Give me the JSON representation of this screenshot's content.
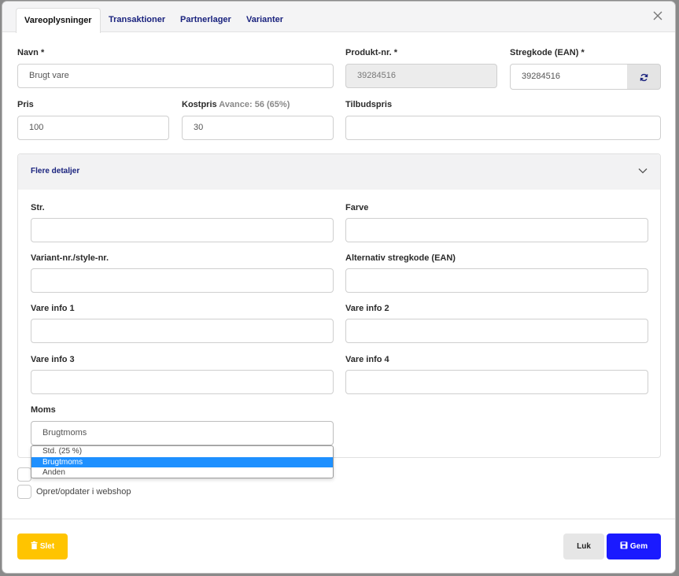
{
  "tabs": [
    {
      "label": "Vareoplysninger"
    },
    {
      "label": "Transaktioner"
    },
    {
      "label": "Partnerlager"
    },
    {
      "label": "Varianter"
    }
  ],
  "fields": {
    "navn": {
      "label": "Navn *",
      "value": "Brugt vare"
    },
    "produktnr": {
      "label": "Produkt-nr. *",
      "value": "39284516"
    },
    "stregkode": {
      "label": "Stregkode (EAN) *",
      "value": "39284516"
    },
    "pris": {
      "label": "Pris",
      "value": "100"
    },
    "kostpris": {
      "label": "Kostpris",
      "avance": "Avance: 56 (65%)",
      "value": "30"
    },
    "tilbudspris": {
      "label": "Tilbudspris",
      "value": ""
    }
  },
  "details": {
    "title": "Flere detaljer",
    "str": {
      "label": "Str.",
      "value": ""
    },
    "farve": {
      "label": "Farve",
      "value": ""
    },
    "variant": {
      "label": "Variant-nr./style-nr.",
      "value": ""
    },
    "alt_ean": {
      "label": "Alternativ stregkode (EAN)",
      "value": ""
    },
    "info1": {
      "label": "Vare info 1",
      "value": ""
    },
    "info2": {
      "label": "Vare info 2",
      "value": ""
    },
    "info3": {
      "label": "Vare info 3",
      "value": ""
    },
    "info4": {
      "label": "Vare info 4",
      "value": ""
    },
    "moms": {
      "label": "Moms",
      "value": "Brugtmoms",
      "options": [
        "Std. (25 %)",
        "Brugtmoms",
        "Anden"
      ]
    }
  },
  "checkboxes": {
    "webshop": {
      "label": "Opret/opdater i webshop"
    }
  },
  "footer": {
    "delete_label": "Slet",
    "close_label": "Luk",
    "save_label": "Gem"
  },
  "colors": {
    "accent": "#1a1aff",
    "delete": "#ffc400",
    "tab_text": "#1a237e",
    "selected_option": "#1e90ff"
  }
}
